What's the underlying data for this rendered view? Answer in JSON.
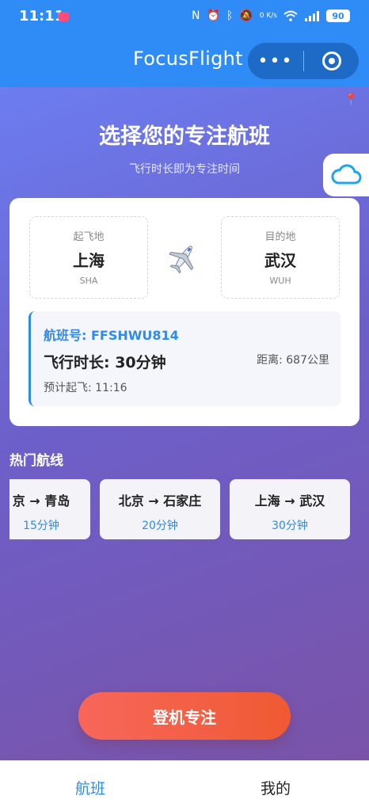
{
  "status_bar": {
    "time": "11:11",
    "icons": [
      "nfc-icon",
      "alarm-icon",
      "bluetooth-icon",
      "mute-icon",
      "speed-icon",
      "wifi-icon",
      "signal-icon"
    ],
    "speed": "0 K/s",
    "battery": "90"
  },
  "titlebar": {
    "title": "FocusFlight",
    "more_icon": "more-dots-icon",
    "close_icon": "target-close-icon"
  },
  "hero": {
    "title": "选择您的专注航班",
    "subtitle": "飞行时长即为专注时间"
  },
  "flight": {
    "from": {
      "label": "起飞地",
      "city": "上海",
      "code": "SHA"
    },
    "to": {
      "label": "目的地",
      "city": "武汉",
      "code": "WUH"
    },
    "flight_no": "航班号: FFSHWU814",
    "duration": "飞行时长: 30分钟",
    "distance": "距离: 687公里",
    "departure": "预计起飞: 11:16"
  },
  "hot_routes": {
    "title": "热门航线",
    "items": [
      {
        "name": "京 → 青岛",
        "time": "15分钟"
      },
      {
        "name": "北京 → 石家庄",
        "time": "20分钟"
      },
      {
        "name": "上海 → 武汉",
        "time": "30分钟"
      }
    ]
  },
  "board_button": "登机专注",
  "tabs": [
    {
      "label": "航班",
      "active": true
    },
    {
      "label": "我的",
      "active": false
    }
  ],
  "colors": {
    "primary": "#2f8cf6",
    "accent_blue": "#2e8bea",
    "button_start": "#f8665a",
    "button_end": "#ef5a33"
  }
}
